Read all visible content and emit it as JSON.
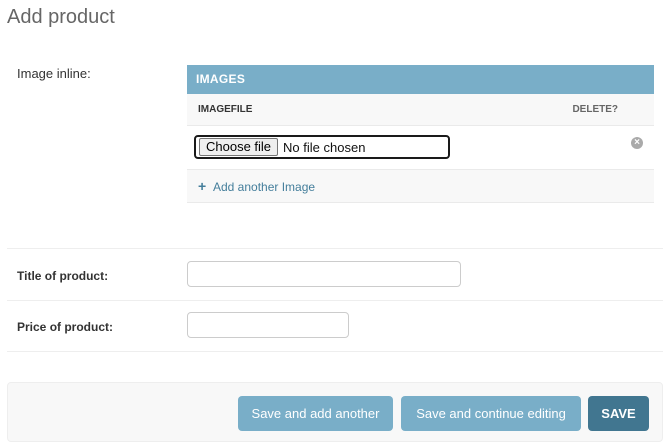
{
  "page": {
    "title": "Add product"
  },
  "inline": {
    "label": "Image inline:",
    "header": "IMAGES",
    "col_imagefile": "IMAGEFILE",
    "col_delete": "DELETE?",
    "file_button": "Choose file",
    "file_status": "No file chosen",
    "delete_icon": "×",
    "add_icon": "+",
    "add_another": "Add another Image"
  },
  "fields": {
    "title_label": "Title of product:",
    "title_value": "",
    "price_label": "Price of product:",
    "price_value": ""
  },
  "actions": {
    "save_add_another": "Save and add another",
    "save_continue": "Save and continue editing",
    "save": "SAVE"
  },
  "colors": {
    "header": "#79aec8",
    "primary_button": "#417690",
    "link": "#447e9b"
  }
}
